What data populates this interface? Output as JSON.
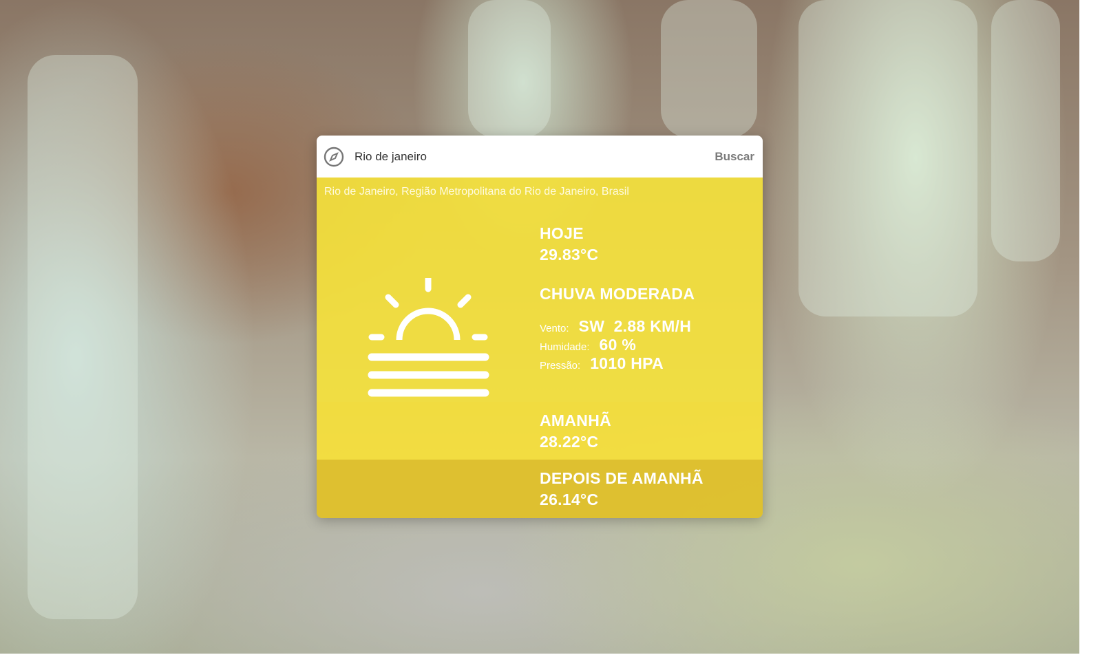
{
  "search": {
    "value": "Rio de janeiro",
    "button_label": "Buscar"
  },
  "location": "Rio de Janeiro, Região Metropolitana do Rio de Janeiro, Brasil",
  "today": {
    "label": "HOJE",
    "temperature": "29.83°C",
    "condition": "CHUVA MODERADA",
    "wind_label": "Vento:",
    "wind_value": "SW  2.88 KM/H",
    "humidity_label": "Humidade:",
    "humidity_value": "60 %",
    "pressure_label": "Pressão:",
    "pressure_value": "1010 HPA",
    "icon": "fog-sunrise-icon"
  },
  "tomorrow": {
    "label": "AMANHÃ",
    "temperature": "28.22°C"
  },
  "day_after": {
    "label": "DEPOIS DE AMANHÃ",
    "temperature": "26.14°C"
  },
  "colors": {
    "today_bg": "#f6e23a",
    "tomorrow_bg": "#f6e038",
    "day_after_bg": "#e0c028",
    "text": "#ffffff"
  }
}
